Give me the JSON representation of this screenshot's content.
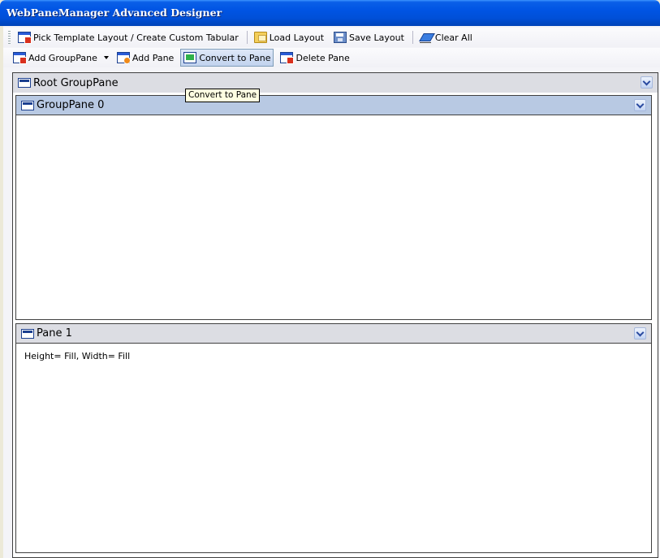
{
  "window": {
    "title": "WebPaneManager Advanced Designer"
  },
  "toolbar1": {
    "pick_template": "Pick Template Layout / Create Custom Tabular",
    "load_layout": "Load Layout",
    "save_layout": "Save Layout",
    "clear_all": "Clear All"
  },
  "toolbar2": {
    "add_grouppane": "Add GroupPane",
    "add_pane": "Add Pane",
    "convert_to_pane": "Convert to Pane",
    "delete_pane": "Delete Pane"
  },
  "tooltip": {
    "text": "Convert to Pane"
  },
  "designer": {
    "root": {
      "title": "Root GroupPane"
    },
    "grouppane0": {
      "title": "GroupPane 0"
    },
    "pane1": {
      "title": "Pane 1",
      "body": "Height= Fill, Width= Fill"
    }
  },
  "icons": {
    "pick_template": "window-red-badge-icon",
    "load_layout": "folder-open-icon",
    "save_layout": "save-icon",
    "clear_all": "eraser-icon",
    "add_grouppane": "window-red-badge-icon",
    "add_pane": "window-orange-badge-icon",
    "convert_to_pane": "window-green-icon",
    "delete_pane": "window-delete-icon",
    "collapse": "chevron-down-icon"
  },
  "colors": {
    "title_bar": "#0054e3",
    "selected_header": "#b8c9e3",
    "header": "#dcdde3",
    "tooltip_bg": "#ffffe1"
  }
}
